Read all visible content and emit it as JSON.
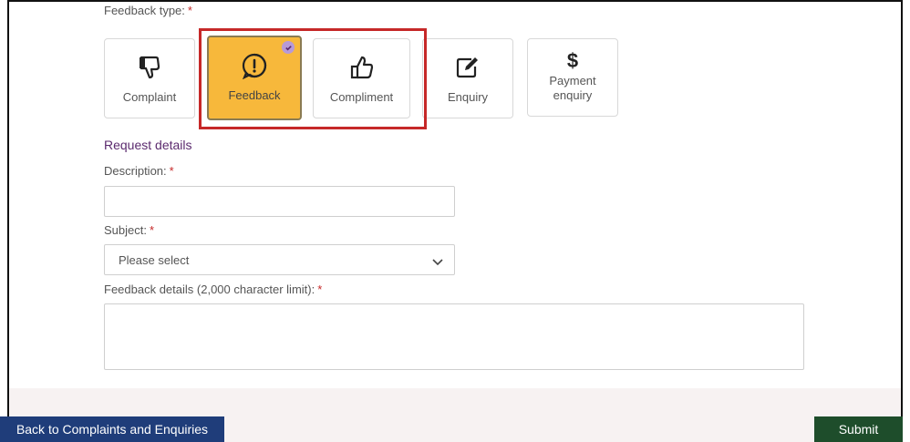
{
  "feedback_type": {
    "label": "Feedback type:",
    "required_mark": "*",
    "options": [
      {
        "label": "Complaint",
        "icon": "thumbs-down-icon",
        "selected": false
      },
      {
        "label": "Feedback",
        "icon": "exclamation-circle-icon",
        "selected": true
      },
      {
        "label": "Compliment",
        "icon": "thumbs-up-icon",
        "selected": false
      },
      {
        "label": "Enquiry",
        "icon": "edit-icon",
        "selected": false
      },
      {
        "label": "Payment enquiry",
        "label_line1": "Payment",
        "label_line2": "enquiry",
        "icon": "dollar-icon",
        "icon_glyph": "$",
        "selected": false
      }
    ]
  },
  "request_details": {
    "heading": "Request details",
    "description": {
      "label": "Description:",
      "required_mark": "*",
      "value": ""
    },
    "subject": {
      "label": "Subject:",
      "required_mark": "*",
      "selected": "Please select"
    },
    "details": {
      "label": "Feedback details (2,000 character limit):",
      "required_mark": "*",
      "value": ""
    }
  },
  "footer": {
    "back_label": "Back to Complaints and Enquiries",
    "submit_label": "Submit"
  },
  "colors": {
    "selected_card": "#f7b83b",
    "highlight_border": "#c62828",
    "heading": "#5b2a6e",
    "back_button": "#1f3d7a",
    "submit_button": "#1e4d2b",
    "check_badge": "#b79ad8"
  }
}
